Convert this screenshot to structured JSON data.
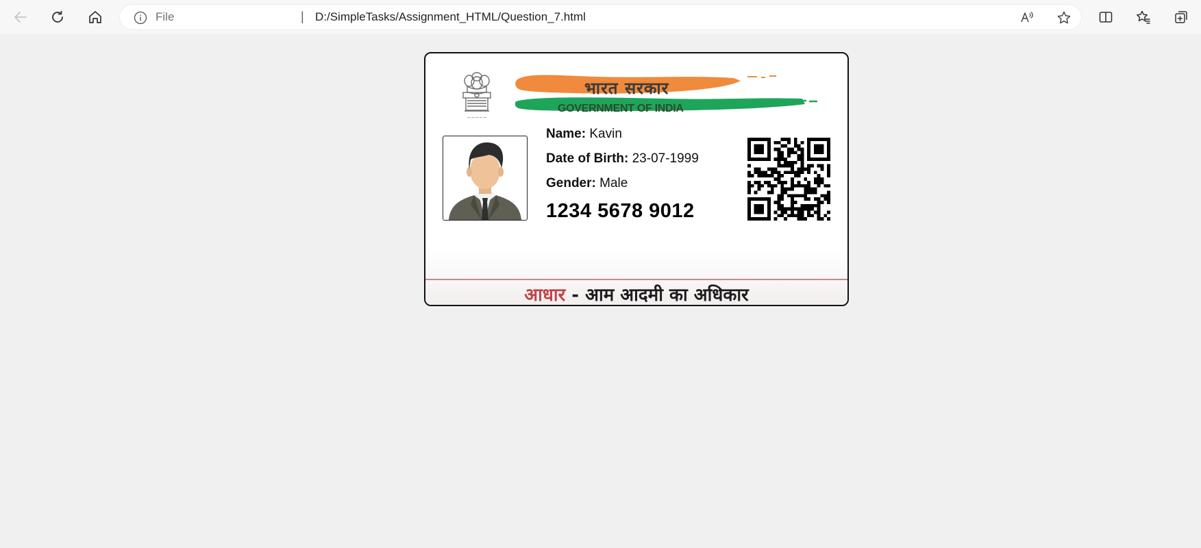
{
  "browser": {
    "address_scheme": "File",
    "address_url": "D:/SimpleTasks/Assignment_HTML/Question_7.html",
    "icons": {
      "back": "back-arrow-icon",
      "refresh": "refresh-icon",
      "home": "home-icon",
      "info": "info-icon",
      "read_aloud": "read-aloud-icon",
      "favorite": "star-icon",
      "split_screen": "split-screen-icon",
      "favorites": "favorites-icon",
      "collections": "collections-icon"
    }
  },
  "card": {
    "gov_hindi": "भारत सरकार",
    "gov_english": "GOVERNMENT OF INDIA",
    "name_label": "Name:",
    "name_value": "Kavin",
    "dob_label": "Date of Birth:",
    "dob_value": "23-07-1999",
    "gender_label": "Gender:",
    "gender_value": "Male",
    "aadhaar_number": "1234 5678 9012",
    "footer_accent": "आधार",
    "footer_rest": " - आम आदमी का अधिकार",
    "colors": {
      "saffron": "#f08a3c",
      "green": "#1ea55a",
      "footer_accent": "#c0454b"
    }
  }
}
